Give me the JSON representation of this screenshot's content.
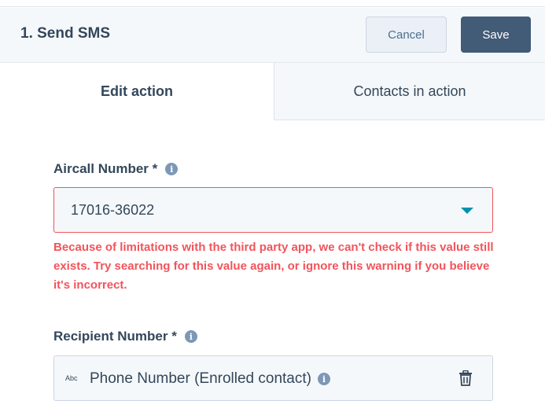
{
  "header": {
    "title": "1. Send SMS",
    "cancel_label": "Cancel",
    "save_label": "Save"
  },
  "tabs": [
    {
      "label": "Edit action",
      "active": true
    },
    {
      "label": "Contacts in action",
      "active": false
    }
  ],
  "aircall_field": {
    "label": "Aircall Number *",
    "value": "17016-36022",
    "warning": "Because of limitations with the third party app, we can't check if this value still exists. Try searching for this value again, or ignore this warning if you believe it's incorrect."
  },
  "recipient_field": {
    "label": "Recipient Number *",
    "type_badge": "Abc",
    "value": "Phone Number (Enrolled contact)"
  },
  "icons": {
    "info": "info-icon",
    "dropdown": "chevron-down-icon",
    "delete": "trash-icon",
    "type": "text-type-icon"
  },
  "colors": {
    "error": "#f2545b",
    "primary_button": "#425b76",
    "caret": "#0091ae",
    "text": "#33475b"
  }
}
